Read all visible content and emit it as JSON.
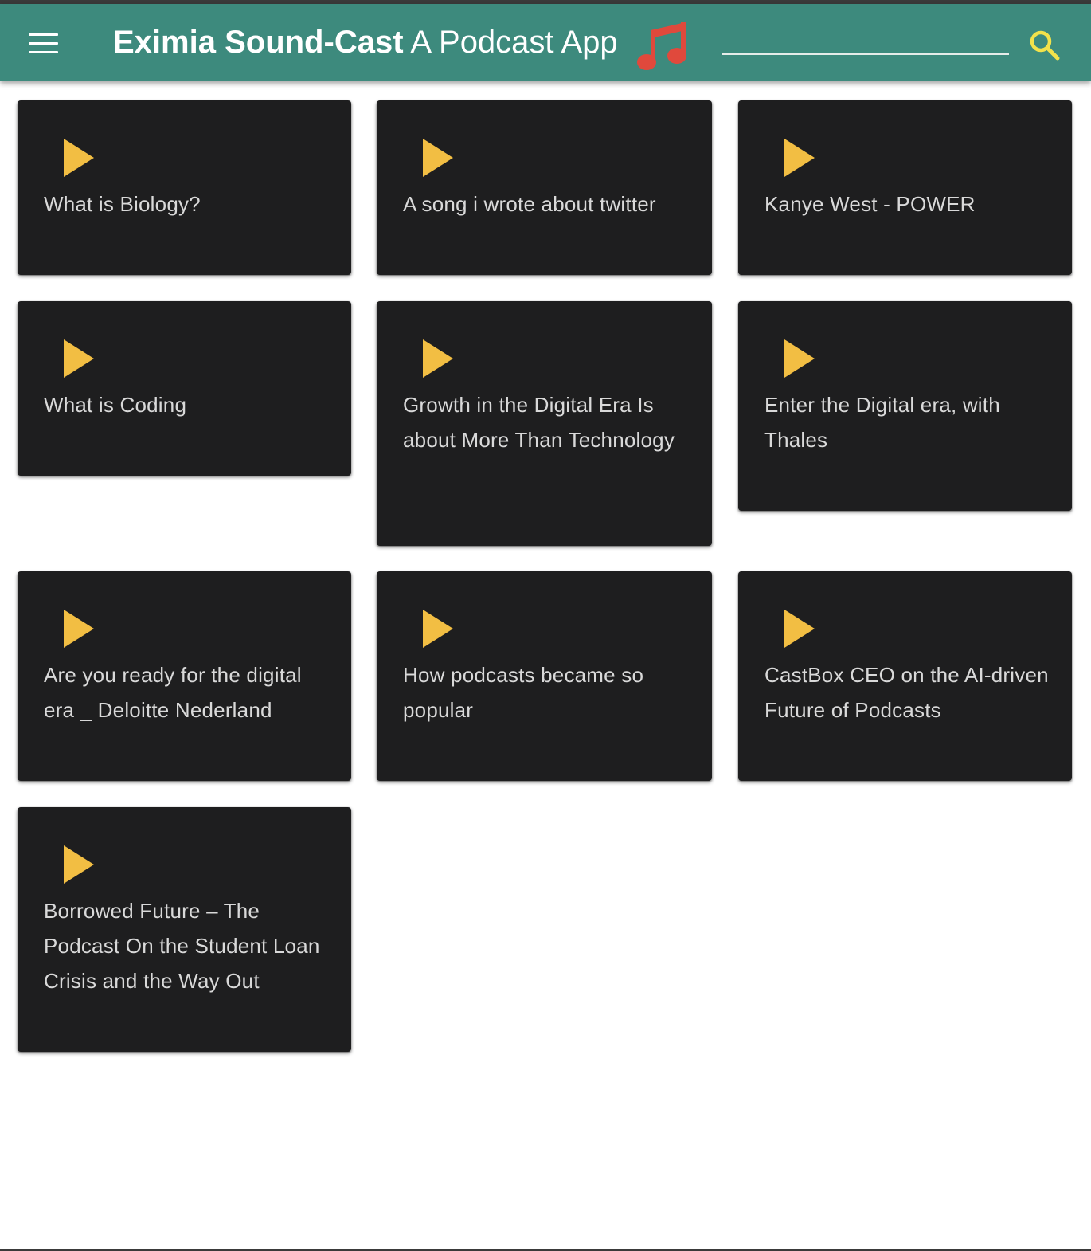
{
  "app": {
    "brand": "Eximia Sound-Cast",
    "subtitle": "A Podcast App",
    "search_placeholder": "",
    "search_value": ""
  },
  "colors": {
    "appbar": "#3d8a7d",
    "card": "#1e1e1f",
    "play_icon": "#f2be43",
    "music_icon": "#e0493c",
    "search_icon": "#f2e24b",
    "card_text": "#d9d9d9"
  },
  "icons": {
    "menu": "menu-icon",
    "music": "music-note-icon",
    "search": "search-icon",
    "play": "play-icon"
  },
  "podcasts": [
    {
      "title": "What is Biology?"
    },
    {
      "title": "A song i wrote about twitter"
    },
    {
      "title": "Kanye West - POWER"
    },
    {
      "title": "What is Coding"
    },
    {
      "title": "Growth in the Digital Era Is about More Than Technology"
    },
    {
      "title": "Enter the Digital era, with Thales"
    },
    {
      "title": "Are you ready for the digital era _ Deloitte Nederland"
    },
    {
      "title": "How podcasts became so popular"
    },
    {
      "title": "CastBox CEO on the AI-driven Future of Podcasts"
    },
    {
      "title": "Borrowed Future – The Podcast On the Student Loan Crisis and the Way Out"
    }
  ]
}
